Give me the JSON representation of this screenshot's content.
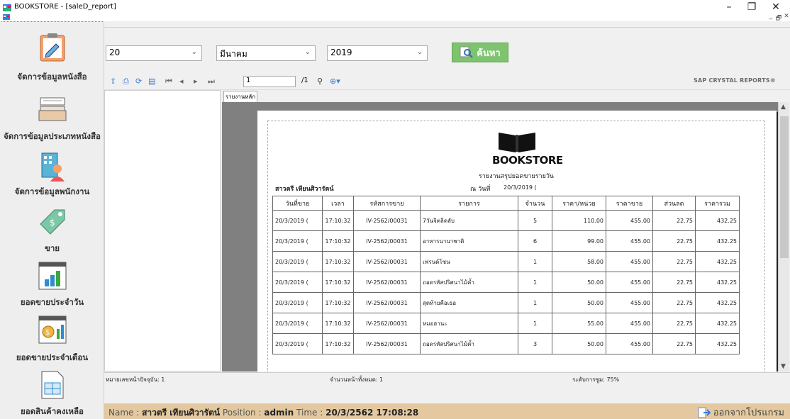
{
  "window": {
    "title": "BOOKSTORE - [saleD_report]",
    "minimize_glyph": "–",
    "restore_glyph": "❐",
    "close_glyph": "✕",
    "mdi_min": "_",
    "mdi_restore": "🗗",
    "mdi_close": "✕"
  },
  "sidebar": {
    "items": [
      {
        "label": "จัดการข้อมูลหนังสือ",
        "icon": "book-edit-icon"
      },
      {
        "label": "จัดการข้อมูลประเภทหนังสือ",
        "icon": "inbox-tray-icon"
      },
      {
        "label": "จัดการข้อมูลพนักงาน",
        "icon": "employee-building-icon"
      },
      {
        "label": "ขาย",
        "icon": "price-tag-icon"
      },
      {
        "label": "ยอดขายประจำวัน",
        "icon": "bar-chart-icon"
      },
      {
        "label": "ยอดขายประจำเดือน",
        "icon": "money-chart-icon"
      },
      {
        "label": "ยอดสินค้าคงเหลือ",
        "icon": "inventory-table-icon"
      }
    ]
  },
  "filters": {
    "day": "20",
    "month": "มีนาคม",
    "year": "2019",
    "search_label": "ค้นหา"
  },
  "viewer": {
    "page_current": "1",
    "page_total": "/1",
    "brand": "SAP CRYSTAL REPORTS®",
    "tab_label": "รายงานหลัก",
    "status_current_page": "หมายเลขหน้าปัจจุบัน: 1",
    "status_total_pages": "จำนวนหน้าทั้งหมด: 1",
    "status_zoom": "ระดับการซูม: 75%"
  },
  "report": {
    "logo_text": "BOOKSTORE",
    "subtitle": "รายงานสรุปยอดขายรายวัน",
    "employee": "สาวตรี เทียนศิวารัตน์",
    "date_label": "ณ วันที่",
    "date_value": "20/3/2019 (",
    "columns": [
      "วันที่ขาย",
      "เวลา",
      "รหัสการขาย",
      "รายการ",
      "จำนวน",
      "ราคา/หน่วย",
      "ราคาขาย",
      "ส่วนลด",
      "ราคารวม"
    ],
    "rows": [
      [
        "20/3/2019 (",
        "17:10:32",
        "IV-2562/00031",
        "7วันจิตลิดลับ",
        "5",
        "110.00",
        "455.00",
        "22.75",
        "432.25"
      ],
      [
        "20/3/2019 (",
        "17:10:32",
        "IV-2562/00031",
        "อาหารนานาชาติ",
        "6",
        "99.00",
        "455.00",
        "22.75",
        "432.25"
      ],
      [
        "20/3/2019 (",
        "17:10:32",
        "IV-2562/00031",
        "เฟรนด์โซน",
        "1",
        "58.00",
        "455.00",
        "22.75",
        "432.25"
      ],
      [
        "20/3/2019 (",
        "17:10:32",
        "IV-2562/00031",
        "ถอดรหัสปริศนาไม้ค้ำ",
        "1",
        "50.00",
        "455.00",
        "22.75",
        "432.25"
      ],
      [
        "20/3/2019 (",
        "17:10:32",
        "IV-2562/00031",
        "สุดท้ายคือเธอ",
        "1",
        "50.00",
        "455.00",
        "22.75",
        "432.25"
      ],
      [
        "20/3/2019 (",
        "17:10:32",
        "IV-2562/00031",
        "หมอฮานะ",
        "1",
        "55.00",
        "455.00",
        "22.75",
        "432.25"
      ],
      [
        "20/3/2019 (",
        "17:10:32",
        "IV-2562/00031",
        "ถอดรหัสปริศนาไม้ค้ำ",
        "3",
        "50.00",
        "455.00",
        "22.75",
        "432.25"
      ]
    ]
  },
  "footer": {
    "name_label": "Name :",
    "name_value": "สาวตรี เทียนศิวารัตน์",
    "position_label": "Position :",
    "position_value": "admin",
    "time_label": "Time :",
    "time_value": "20/3/2562 17:08:28",
    "exit_label": "ออกจากโปรแกรม"
  },
  "colors": {
    "search_button": "#7ec36e",
    "bottom_bar": "#e4c9a0",
    "report_background": "#808080"
  }
}
